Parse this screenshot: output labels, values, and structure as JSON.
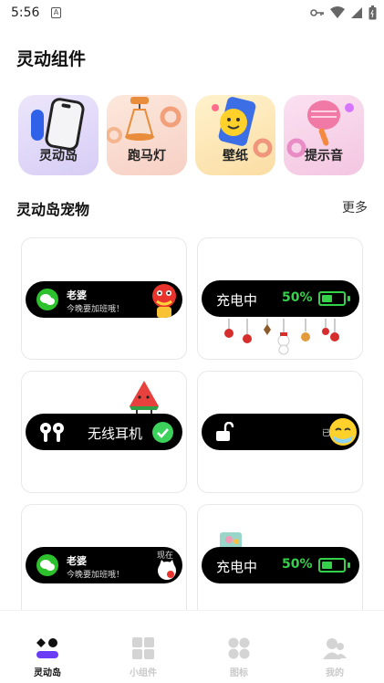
{
  "status_bar": {
    "time": "5:56",
    "notice_icon": "A"
  },
  "page_title": "灵动组件",
  "categories": [
    {
      "label": "灵动岛",
      "icon": "phone-icon",
      "bg": "#dfd6f7"
    },
    {
      "label": "跑马灯",
      "icon": "lamp-icon",
      "bg": "#f9d9cc"
    },
    {
      "label": "壁纸",
      "icon": "wallpaper-phone-icon",
      "bg": "#fbe6b9"
    },
    {
      "label": "提示音",
      "icon": "microphone-icon",
      "bg": "#f7cde7"
    }
  ],
  "section": {
    "title": "灵动岛宠物",
    "more": "更多"
  },
  "pets": {
    "wechat1": {
      "name": "老婆",
      "message": "今晚要加班哦！"
    },
    "charge1": {
      "label": "充电中",
      "percent": "50%",
      "level": 0.5
    },
    "earbuds": {
      "label": "无线耳机"
    },
    "unlock": {
      "label": "已"
    },
    "wechat2": {
      "name": "老婆",
      "message": "今晚要加班哦！",
      "overlay": "现在"
    },
    "charge2": {
      "label": "充电中",
      "percent": "50%",
      "level": 0.5
    }
  },
  "tabs": [
    {
      "label": "灵动岛",
      "icon": "dynamic-island-icon",
      "active": true
    },
    {
      "label": "小组件",
      "icon": "widget-grid-icon",
      "active": false
    },
    {
      "label": "图标",
      "icon": "icons-grid-icon",
      "active": false
    },
    {
      "label": "我的",
      "icon": "profile-icon",
      "active": false
    }
  ],
  "colors": {
    "accent_green": "#35d14b",
    "wechat_green": "#2ec12e",
    "active_tab": "#111111",
    "inactive_tab": "#c9c9c9"
  }
}
